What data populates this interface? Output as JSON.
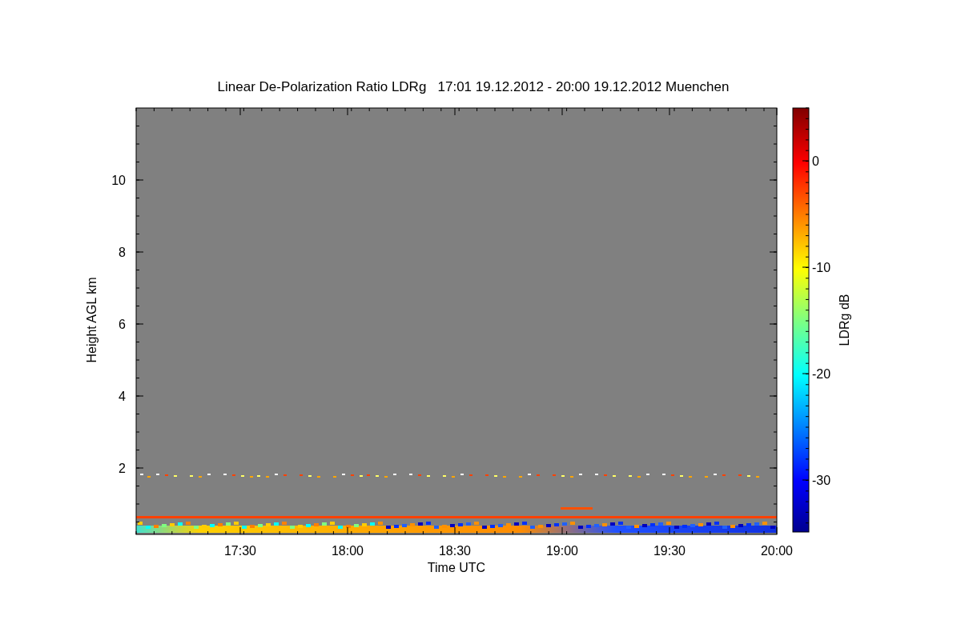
{
  "title": "Linear De-Polarization Ratio LDRg   17:01 19.12.2012 - 20:00 19.12.2012 Muenchen",
  "x_axis": {
    "label": "Time UTC",
    "ticks": [
      "17:30",
      "18:00",
      "18:30",
      "19:00",
      "19:30",
      "20:00"
    ]
  },
  "y_axis": {
    "label": "Height AGL km",
    "ticks": [
      "10",
      "8",
      "6",
      "4",
      "2"
    ]
  },
  "colorbar": {
    "label": "LDRg dB",
    "ticks": [
      "0",
      "-10",
      "-20",
      "-30"
    ]
  }
}
